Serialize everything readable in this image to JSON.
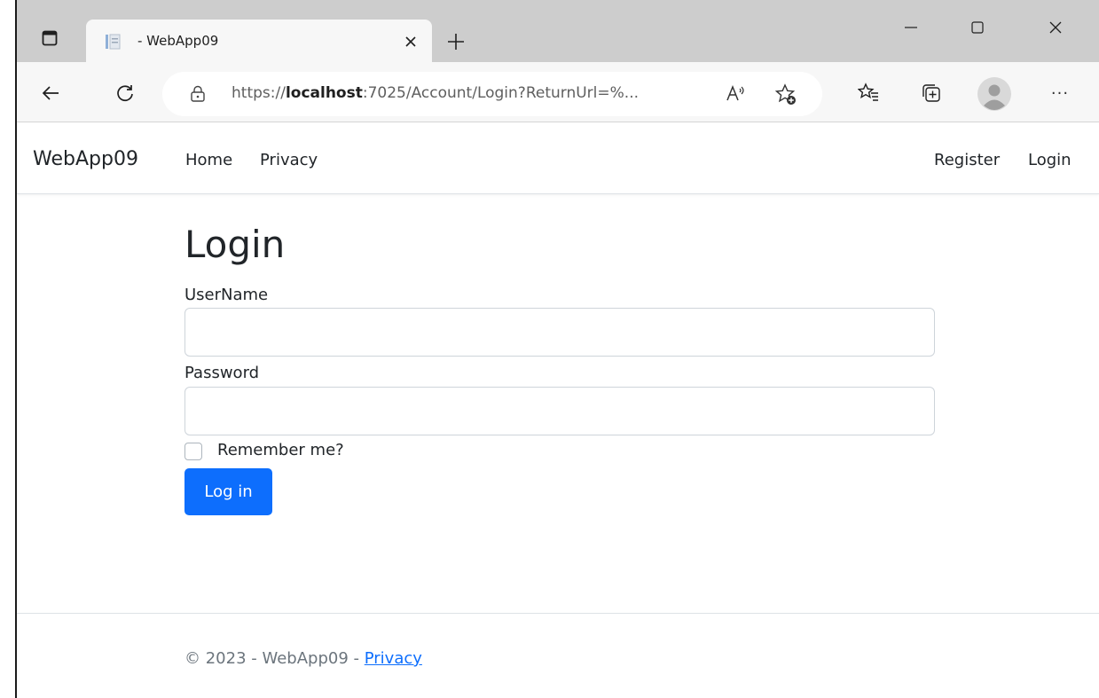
{
  "browser": {
    "tab": {
      "title": "- WebApp09"
    },
    "address": {
      "url_prefix": "https://",
      "url_host": "localhost",
      "url_rest": ":7025/Account/Login?ReturnUrl=%..."
    },
    "more_label": "···"
  },
  "site": {
    "brand": "WebApp09",
    "nav_left": [
      "Home",
      "Privacy"
    ],
    "nav_right": [
      "Register",
      "Login"
    ]
  },
  "form": {
    "title": "Login",
    "username_label": "UserName",
    "username_value": "",
    "password_label": "Password",
    "password_value": "",
    "remember_label": "Remember me?",
    "remember_checked": false,
    "submit_label": "Log in"
  },
  "footer": {
    "text": "© 2023 - WebApp09 - ",
    "link": "Privacy"
  },
  "colors": {
    "primary": "#0d6efd",
    "tabstrip": "#cdcdcd",
    "toolbar": "#f7f7f7"
  },
  "icons": [
    "tab-actions-icon",
    "page-favicon",
    "close-icon",
    "plus-icon",
    "minimize-icon",
    "maximize-icon",
    "back-arrow-icon",
    "reload-icon",
    "lock-icon",
    "read-aloud-icon",
    "add-favorite-icon",
    "favorites-icon",
    "collections-icon",
    "profile-avatar-icon"
  ]
}
